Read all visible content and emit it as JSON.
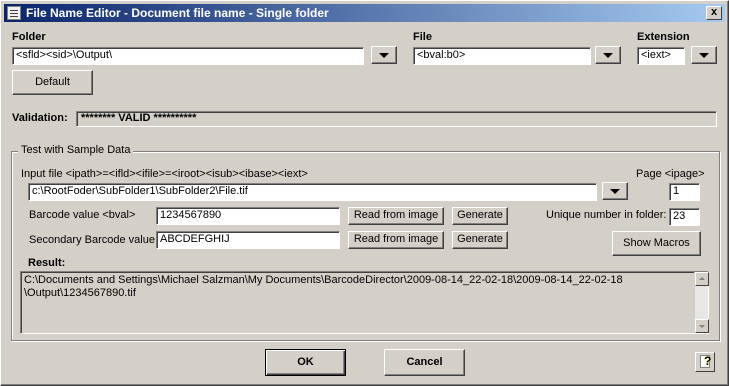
{
  "window": {
    "title": "File Name Editor - Document file name - Single folder",
    "close_glyph": "x"
  },
  "folder": {
    "label": "Folder",
    "value": "<sfld><sid>\\Output\\"
  },
  "file": {
    "label": "File",
    "value": "<bval:b0>"
  },
  "extension": {
    "label": "Extension",
    "value": "<iext>"
  },
  "default_button": "Default",
  "validation": {
    "label": "Validation:",
    "value": "******** VALID **********"
  },
  "test": {
    "group_title": "Test with Sample Data",
    "input_label": "Input file <ipath>=<ifld><ifile>=<iroot><isub><ibase><iext>",
    "input_value": "c:\\RootFoder\\SubFolder1\\SubFolder2\\File.tif",
    "page_label": "Page <ipage>",
    "page_value": "1",
    "barcode_label": "Barcode value <bval>",
    "barcode_value": "1234567890",
    "secondary_label": "Secondary Barcode value",
    "secondary_value": "ABCDEFGHIJ",
    "read_label": "Read from image",
    "generate_label": "Generate",
    "unique_label": "Unique number in folder:",
    "unique_value": "23",
    "show_macros": "Show Macros",
    "result_label": "Result:",
    "result_lines": [
      "C:\\Documents and Settings\\Michael Salzman\\My Documents\\BarcodeDirector\\2009-08-14_22-02-18\\2009-08-14_22-02-18",
      "\\Output\\1234567890.tif"
    ]
  },
  "ok_label": "OK",
  "cancel_label": "Cancel",
  "icons": [
    "app-icon",
    "close-icon",
    "chevron-down-icon",
    "help-icon",
    "scroll-up-icon",
    "scroll-down-icon"
  ]
}
